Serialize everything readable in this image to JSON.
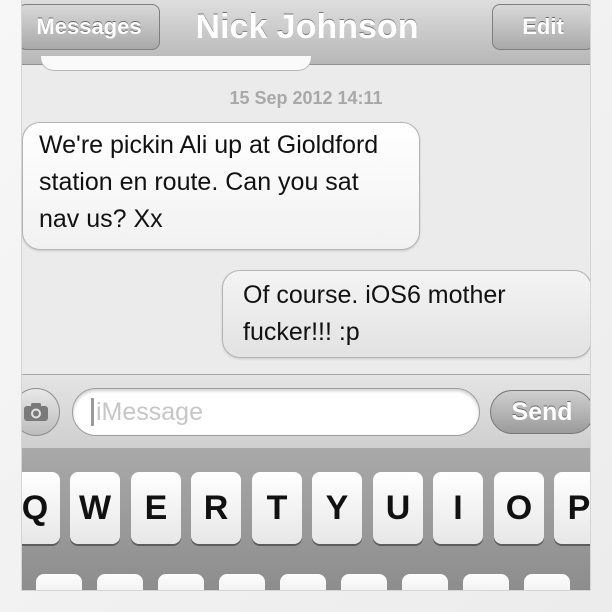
{
  "navbar": {
    "back_label": "Messages",
    "title": "Nick Johnson",
    "edit_label": "Edit"
  },
  "conversation": {
    "timestamp": "15 Sep 2012 14:11",
    "messages": [
      {
        "direction": "incoming",
        "text": "We're pickin Ali up at Gioldford station en route. Can you sat nav us? Xx"
      },
      {
        "direction": "outgoing",
        "text": "Of course. iOS6 mother fucker!!! :p"
      }
    ]
  },
  "composer": {
    "camera_icon": "camera-icon",
    "placeholder": "iMessage",
    "send_label": "Send"
  },
  "keyboard": {
    "row1": [
      "Q",
      "W",
      "E",
      "R",
      "T",
      "Y",
      "U",
      "I",
      "O",
      "P"
    ]
  }
}
